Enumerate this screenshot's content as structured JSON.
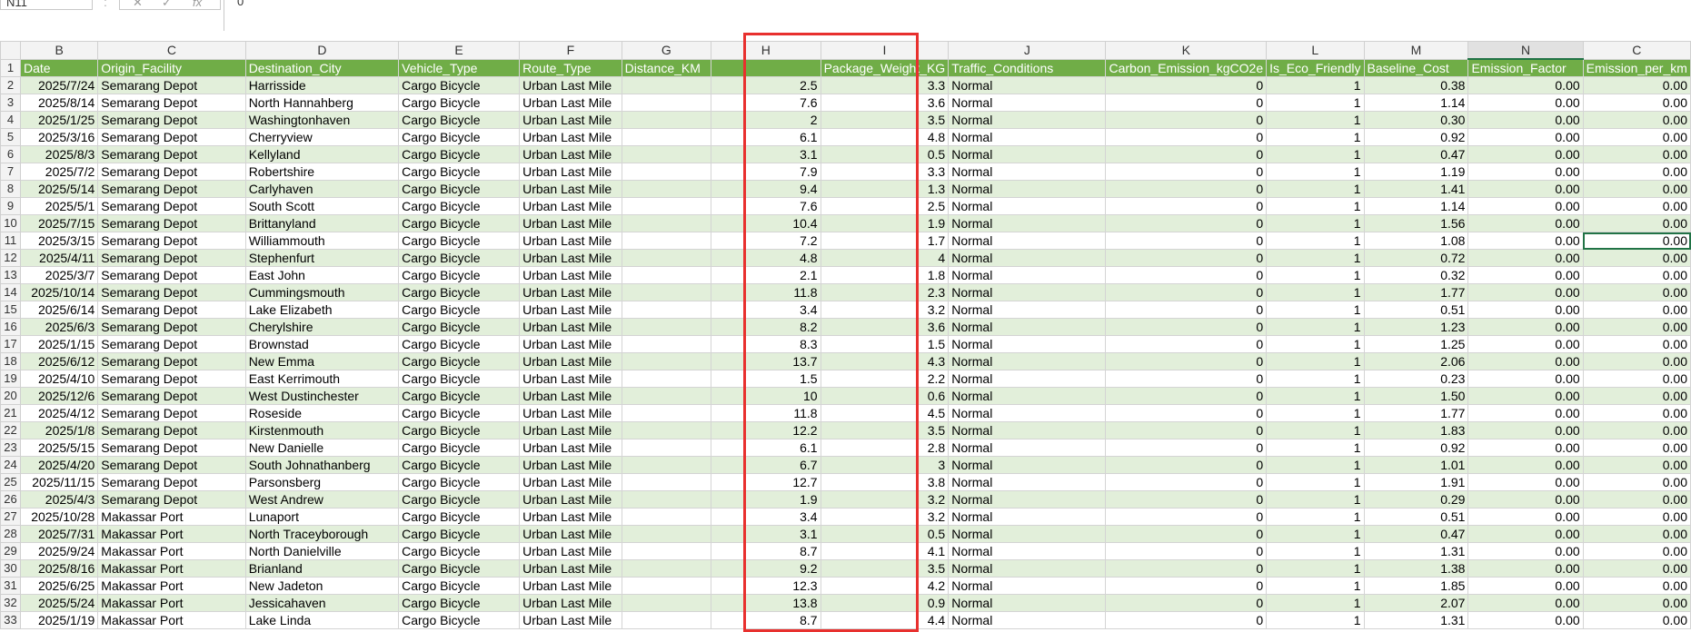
{
  "formula_bar": {
    "name_box": "N11",
    "dots": ":",
    "cancel_glyph": "✕",
    "enter_glyph": "✓",
    "fx_glyph": "fx",
    "value": "0"
  },
  "column_letters": [
    "B",
    "C",
    "D",
    "E",
    "F",
    "G",
    "H",
    "I",
    "J",
    "K",
    "L",
    "M",
    "N",
    "C"
  ],
  "headers": [
    "Date",
    "Origin_Facility",
    "Destination_City",
    "Vehicle_Type",
    "Route_Type",
    "Distance_KM",
    "Package_Weight_KG",
    "Traffic_Conditions",
    "Carbon_Emission_kgCO2e",
    "Is_Eco_Friendly",
    "Baseline_Cost",
    "Emission_Factor",
    "Emission_per_km"
  ],
  "rows": [
    [
      "2025/7/24",
      "Semarang Depot",
      "Harrisside",
      "Cargo Bicycle",
      "Urban Last Mile",
      "",
      "2.5",
      "3.3",
      "Normal",
      "0",
      "1",
      "0.38",
      "0.00",
      "0.00"
    ],
    [
      "2025/8/14",
      "Semarang Depot",
      "North Hannahberg",
      "Cargo Bicycle",
      "Urban Last Mile",
      "",
      "7.6",
      "3.6",
      "Normal",
      "0",
      "1",
      "1.14",
      "0.00",
      "0.00"
    ],
    [
      "2025/1/25",
      "Semarang Depot",
      "Washingtonhaven",
      "Cargo Bicycle",
      "Urban Last Mile",
      "",
      "2",
      "3.5",
      "Normal",
      "0",
      "1",
      "0.30",
      "0.00",
      "0.00"
    ],
    [
      "2025/3/16",
      "Semarang Depot",
      "Cherryview",
      "Cargo Bicycle",
      "Urban Last Mile",
      "",
      "6.1",
      "4.8",
      "Normal",
      "0",
      "1",
      "0.92",
      "0.00",
      "0.00"
    ],
    [
      "2025/8/3",
      "Semarang Depot",
      "Kellyland",
      "Cargo Bicycle",
      "Urban Last Mile",
      "",
      "3.1",
      "0.5",
      "Normal",
      "0",
      "1",
      "0.47",
      "0.00",
      "0.00"
    ],
    [
      "2025/7/2",
      "Semarang Depot",
      "Robertshire",
      "Cargo Bicycle",
      "Urban Last Mile",
      "",
      "7.9",
      "3.3",
      "Normal",
      "0",
      "1",
      "1.19",
      "0.00",
      "0.00"
    ],
    [
      "2025/5/14",
      "Semarang Depot",
      "Carlyhaven",
      "Cargo Bicycle",
      "Urban Last Mile",
      "",
      "9.4",
      "1.3",
      "Normal",
      "0",
      "1",
      "1.41",
      "0.00",
      "0.00"
    ],
    [
      "2025/5/1",
      "Semarang Depot",
      "South Scott",
      "Cargo Bicycle",
      "Urban Last Mile",
      "",
      "7.6",
      "2.5",
      "Normal",
      "0",
      "1",
      "1.14",
      "0.00",
      "0.00"
    ],
    [
      "2025/7/15",
      "Semarang Depot",
      "Brittanyland",
      "Cargo Bicycle",
      "Urban Last Mile",
      "",
      "10.4",
      "1.9",
      "Normal",
      "0",
      "1",
      "1.56",
      "0.00",
      "0.00"
    ],
    [
      "2025/3/15",
      "Semarang Depot",
      "Williammouth",
      "Cargo Bicycle",
      "Urban Last Mile",
      "",
      "7.2",
      "1.7",
      "Normal",
      "0",
      "1",
      "1.08",
      "0.00",
      "0.00"
    ],
    [
      "2025/4/11",
      "Semarang Depot",
      "Stephenfurt",
      "Cargo Bicycle",
      "Urban Last Mile",
      "",
      "4.8",
      "4",
      "Normal",
      "0",
      "1",
      "0.72",
      "0.00",
      "0.00"
    ],
    [
      "2025/3/7",
      "Semarang Depot",
      "East John",
      "Cargo Bicycle",
      "Urban Last Mile",
      "",
      "2.1",
      "1.8",
      "Normal",
      "0",
      "1",
      "0.32",
      "0.00",
      "0.00"
    ],
    [
      "2025/10/14",
      "Semarang Depot",
      "Cummingsmouth",
      "Cargo Bicycle",
      "Urban Last Mile",
      "",
      "11.8",
      "2.3",
      "Normal",
      "0",
      "1",
      "1.77",
      "0.00",
      "0.00"
    ],
    [
      "2025/6/14",
      "Semarang Depot",
      "Lake Elizabeth",
      "Cargo Bicycle",
      "Urban Last Mile",
      "",
      "3.4",
      "3.2",
      "Normal",
      "0",
      "1",
      "0.51",
      "0.00",
      "0.00"
    ],
    [
      "2025/6/3",
      "Semarang Depot",
      "Cherylshire",
      "Cargo Bicycle",
      "Urban Last Mile",
      "",
      "8.2",
      "3.6",
      "Normal",
      "0",
      "1",
      "1.23",
      "0.00",
      "0.00"
    ],
    [
      "2025/1/15",
      "Semarang Depot",
      "Brownstad",
      "Cargo Bicycle",
      "Urban Last Mile",
      "",
      "8.3",
      "1.5",
      "Normal",
      "0",
      "1",
      "1.25",
      "0.00",
      "0.00"
    ],
    [
      "2025/6/12",
      "Semarang Depot",
      "New Emma",
      "Cargo Bicycle",
      "Urban Last Mile",
      "",
      "13.7",
      "4.3",
      "Normal",
      "0",
      "1",
      "2.06",
      "0.00",
      "0.00"
    ],
    [
      "2025/4/10",
      "Semarang Depot",
      "East Kerrimouth",
      "Cargo Bicycle",
      "Urban Last Mile",
      "",
      "1.5",
      "2.2",
      "Normal",
      "0",
      "1",
      "0.23",
      "0.00",
      "0.00"
    ],
    [
      "2025/12/6",
      "Semarang Depot",
      "West Dustinchester",
      "Cargo Bicycle",
      "Urban Last Mile",
      "",
      "10",
      "0.6",
      "Normal",
      "0",
      "1",
      "1.50",
      "0.00",
      "0.00"
    ],
    [
      "2025/4/12",
      "Semarang Depot",
      "Roseside",
      "Cargo Bicycle",
      "Urban Last Mile",
      "",
      "11.8",
      "4.5",
      "Normal",
      "0",
      "1",
      "1.77",
      "0.00",
      "0.00"
    ],
    [
      "2025/1/8",
      "Semarang Depot",
      "Kirstenmouth",
      "Cargo Bicycle",
      "Urban Last Mile",
      "",
      "12.2",
      "3.5",
      "Normal",
      "0",
      "1",
      "1.83",
      "0.00",
      "0.00"
    ],
    [
      "2025/5/15",
      "Semarang Depot",
      "New Danielle",
      "Cargo Bicycle",
      "Urban Last Mile",
      "",
      "6.1",
      "2.8",
      "Normal",
      "0",
      "1",
      "0.92",
      "0.00",
      "0.00"
    ],
    [
      "2025/4/20",
      "Semarang Depot",
      "South Johnathanberg",
      "Cargo Bicycle",
      "Urban Last Mile",
      "",
      "6.7",
      "3",
      "Normal",
      "0",
      "1",
      "1.01",
      "0.00",
      "0.00"
    ],
    [
      "2025/11/15",
      "Semarang Depot",
      "Parsonsberg",
      "Cargo Bicycle",
      "Urban Last Mile",
      "",
      "12.7",
      "3.8",
      "Normal",
      "0",
      "1",
      "1.91",
      "0.00",
      "0.00"
    ],
    [
      "2025/4/3",
      "Semarang Depot",
      "West Andrew",
      "Cargo Bicycle",
      "Urban Last Mile",
      "",
      "1.9",
      "3.2",
      "Normal",
      "0",
      "1",
      "0.29",
      "0.00",
      "0.00"
    ],
    [
      "2025/10/28",
      "Makassar Port",
      "Lunaport",
      "Cargo Bicycle",
      "Urban Last Mile",
      "",
      "3.4",
      "3.2",
      "Normal",
      "0",
      "1",
      "0.51",
      "0.00",
      "0.00"
    ],
    [
      "2025/7/31",
      "Makassar Port",
      "North Traceyborough",
      "Cargo Bicycle",
      "Urban Last Mile",
      "",
      "3.1",
      "0.5",
      "Normal",
      "0",
      "1",
      "0.47",
      "0.00",
      "0.00"
    ],
    [
      "2025/9/24",
      "Makassar Port",
      "North Danielville",
      "Cargo Bicycle",
      "Urban Last Mile",
      "",
      "8.7",
      "4.1",
      "Normal",
      "0",
      "1",
      "1.31",
      "0.00",
      "0.00"
    ],
    [
      "2025/8/16",
      "Makassar Port",
      "Brianland",
      "Cargo Bicycle",
      "Urban Last Mile",
      "",
      "9.2",
      "3.5",
      "Normal",
      "0",
      "1",
      "1.38",
      "0.00",
      "0.00"
    ],
    [
      "2025/6/25",
      "Makassar Port",
      "New Jadeton",
      "Cargo Bicycle",
      "Urban Last Mile",
      "",
      "12.3",
      "4.2",
      "Normal",
      "0",
      "1",
      "1.85",
      "0.00",
      "0.00"
    ],
    [
      "2025/5/24",
      "Makassar Port",
      "Jessicahaven",
      "Cargo Bicycle",
      "Urban Last Mile",
      "",
      "13.8",
      "0.9",
      "Normal",
      "0",
      "1",
      "2.07",
      "0.00",
      "0.00"
    ],
    [
      "2025/1/19",
      "Makassar Port",
      "Lake Linda",
      "Cargo Bicycle",
      "Urban Last Mile",
      "",
      "8.7",
      "4.4",
      "Normal",
      "0",
      "1",
      "1.31",
      "0.00",
      "0.00"
    ]
  ]
}
